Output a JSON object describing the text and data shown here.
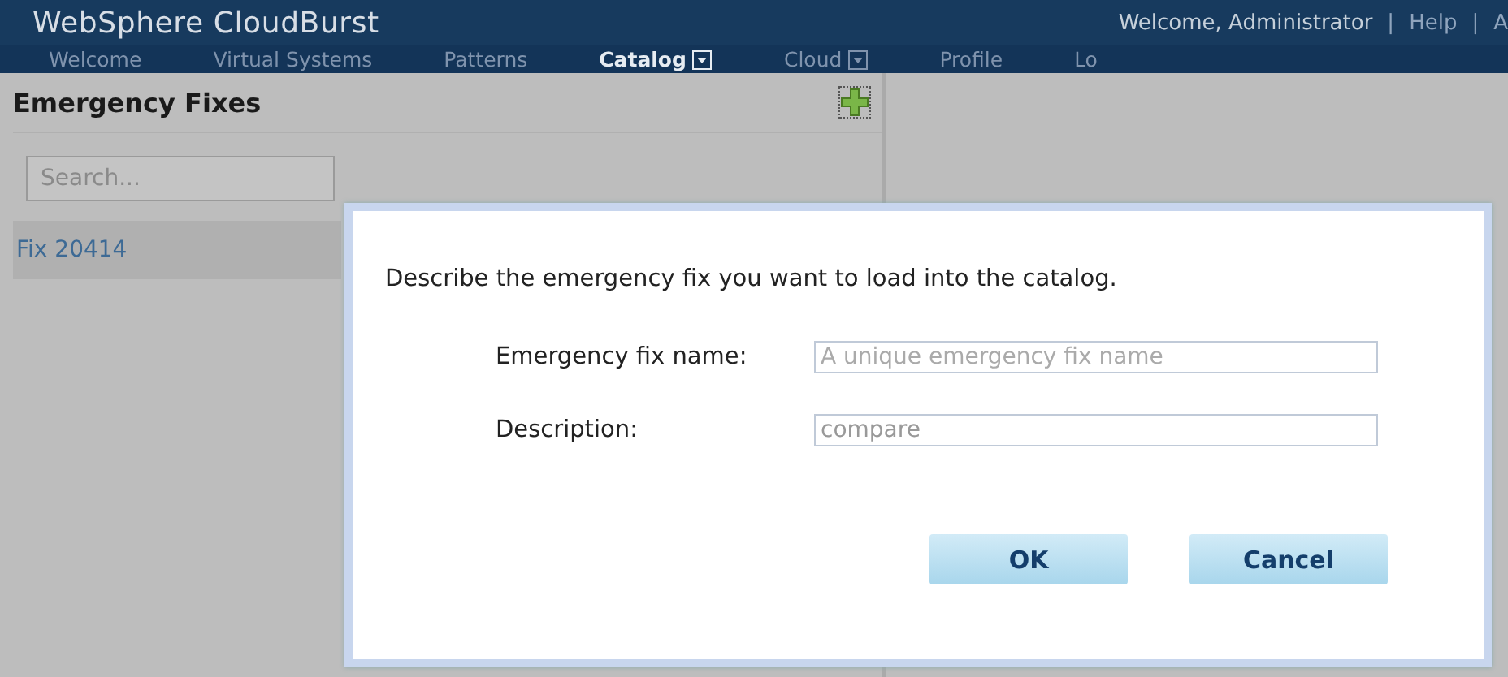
{
  "header": {
    "title": "WebSphere CloudBurst",
    "links": [
      {
        "label": "Welcome, Administrator",
        "kind": "text"
      },
      {
        "label": "|",
        "kind": "separator"
      },
      {
        "label": "Help",
        "kind": "link"
      },
      {
        "label": "|",
        "kind": "separator"
      },
      {
        "label": "A",
        "kind": "link"
      }
    ]
  },
  "nav": [
    {
      "label": "Welcome",
      "selected": false,
      "dropdown": false
    },
    {
      "label": "Virtual Systems",
      "selected": false,
      "dropdown": false
    },
    {
      "label": "Patterns",
      "selected": false,
      "dropdown": false
    },
    {
      "label": "Catalog",
      "selected": true,
      "dropdown": true
    },
    {
      "label": "Cloud",
      "selected": false,
      "dropdown": true
    },
    {
      "label": "Profile",
      "selected": false,
      "dropdown": false
    },
    {
      "label": "Lo",
      "selected": false,
      "dropdown": false
    }
  ],
  "sidebar": {
    "title": "Emergency Fixes",
    "search": {
      "placeholder": "Search..."
    },
    "items": [
      {
        "label": "Fix 20414",
        "selected": true
      }
    ]
  },
  "dialog": {
    "prompt": "Describe the emergency fix you want to load into the catalog.",
    "fields": [
      {
        "label": "Emergency fix name:",
        "placeholder": "A unique emergency fix name"
      },
      {
        "label": "Description:",
        "value": "compare"
      }
    ],
    "buttons": [
      "OK",
      "Cancel"
    ]
  }
}
